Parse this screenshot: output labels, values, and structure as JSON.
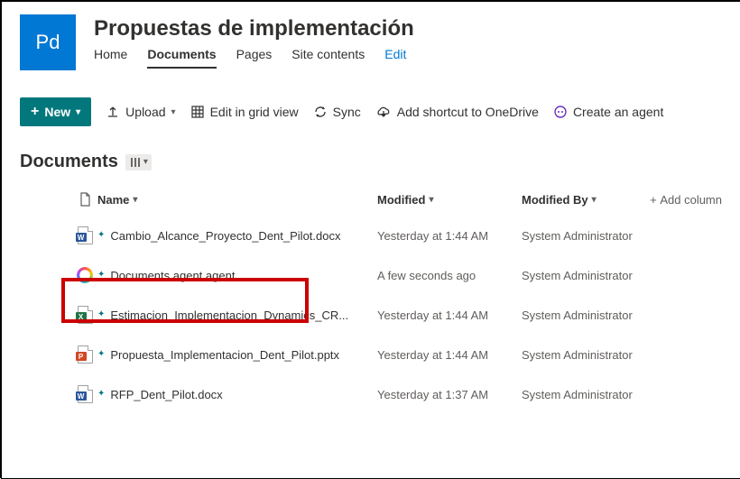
{
  "site": {
    "logo_text": "Pd",
    "title": "Propuestas de implementación",
    "nav": {
      "home": "Home",
      "documents": "Documents",
      "pages": "Pages",
      "site_contents": "Site contents",
      "edit": "Edit"
    }
  },
  "commands": {
    "new": "New",
    "upload": "Upload",
    "edit_grid": "Edit in grid view",
    "sync": "Sync",
    "add_onedrive": "Add shortcut to OneDrive",
    "create_agent": "Create an agent"
  },
  "library": {
    "title": "Documents"
  },
  "columns": {
    "name": "Name",
    "modified": "Modified",
    "modified_by": "Modified By",
    "add": "Add column"
  },
  "files": [
    {
      "type": "word",
      "badge": "W",
      "name": "Cambio_Alcance_Proyecto_Dent_Pilot.docx",
      "modified": "Yesterday at 1:44 AM",
      "by": "System Administrator",
      "is_new": true
    },
    {
      "type": "agent",
      "badge": "",
      "name": "Documents agent.agent",
      "modified": "A few seconds ago",
      "by": "System Administrator",
      "is_new": true,
      "highlighted": true
    },
    {
      "type": "excel",
      "badge": "X",
      "name": "Estimacion_Implementacion_Dynamics_CR...",
      "modified": "Yesterday at 1:44 AM",
      "by": "System Administrator",
      "is_new": true
    },
    {
      "type": "ppt",
      "badge": "P",
      "name": "Propuesta_Implementacion_Dent_Pilot.pptx",
      "modified": "Yesterday at 1:44 AM",
      "by": "System Administrator",
      "is_new": true
    },
    {
      "type": "word",
      "badge": "W",
      "name": "RFP_Dent_Pilot.docx",
      "modified": "Yesterday at 1:37 AM",
      "by": "System Administrator",
      "is_new": true
    }
  ]
}
